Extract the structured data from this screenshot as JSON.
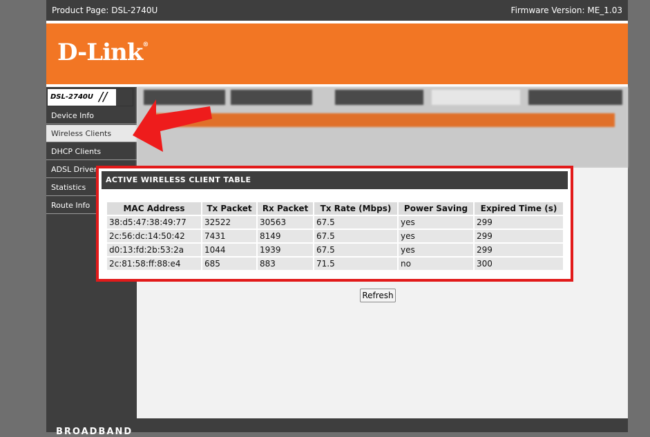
{
  "header": {
    "product_label": "Product Page: DSL-2740U",
    "firmware_label": "Firmware Version: ME_1.03"
  },
  "brand": {
    "logo_text": "D-Link",
    "reg_mark": "®",
    "model": "DSL-2740U",
    "slashes": "//"
  },
  "sidebar": {
    "items": [
      {
        "label": "Device Info"
      },
      {
        "label": "Wireless Clients"
      },
      {
        "label": "DHCP Clients"
      },
      {
        "label": "ADSL Driver"
      },
      {
        "label": "Statistics"
      },
      {
        "label": "Route Info"
      }
    ]
  },
  "table": {
    "title": "ACTIVE WIRELESS CLIENT TABLE",
    "columns": [
      "MAC Address",
      "Tx Packet",
      "Rx Packet",
      "Tx Rate (Mbps)",
      "Power Saving",
      "Expired Time (s)"
    ],
    "rows": [
      [
        "38:d5:47:38:49:77",
        "32522",
        "30563",
        "67.5",
        "yes",
        "299"
      ],
      [
        "2c:56:dc:14:50:42",
        "7431",
        "8149",
        "67.5",
        "yes",
        "299"
      ],
      [
        "d0:13:fd:2b:53:2a",
        "1044",
        "1939",
        "67.5",
        "yes",
        "299"
      ],
      [
        "2c:81:58:ff:88:e4",
        "685",
        "883",
        "71.5",
        "no",
        "300"
      ]
    ]
  },
  "actions": {
    "refresh_label": "Refresh"
  },
  "footer": {
    "text": "BROADBAND"
  },
  "colors": {
    "brand_orange": "#f27624",
    "dark_gray": "#3e3e3e",
    "highlight_red": "#e21a1a"
  }
}
